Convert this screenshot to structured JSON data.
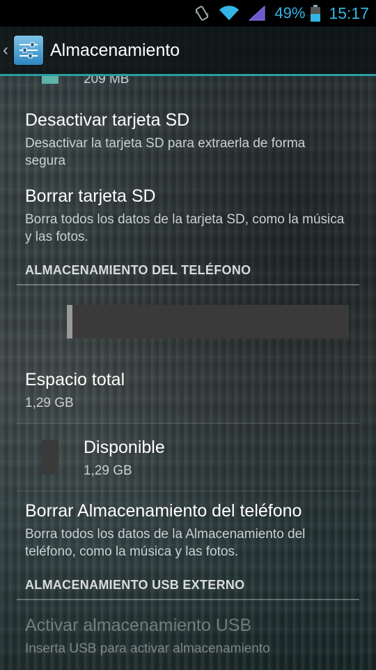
{
  "status_bar": {
    "battery_percent": "49%",
    "time": "15:17",
    "icons": [
      "vibrate-icon",
      "wifi-icon",
      "signal-icon",
      "battery-icon"
    ],
    "accent_color": "#33b5e5"
  },
  "action_bar": {
    "title": "Almacenamiento",
    "icon": "settings-sliders-icon"
  },
  "sd_card": {
    "partial_value": "209 MB",
    "swatch_color": "#5fb3a8",
    "unmount": {
      "title": "Desactivar tarjeta SD",
      "summary": "Desactivar la tarjeta SD para extraerla de forma segura"
    },
    "erase": {
      "title": "Borrar tarjeta SD",
      "summary": "Borra todos los datos de la tarjeta SD, como la música y las fotos."
    }
  },
  "phone_storage": {
    "header": "ALMACENAMIENTO DEL TELÉFONO",
    "usage_bar_used_fraction": 0.02,
    "total": {
      "title": "Espacio total",
      "value": "1,29 GB"
    },
    "available": {
      "title": "Disponible",
      "value": "1,29 GB",
      "swatch_color": "#3a3a3a"
    },
    "erase": {
      "title": "Borrar Almacenamiento del teléfono",
      "summary": "Borra todos los datos de la Almacenamiento del teléfono, como la música y las fotos."
    }
  },
  "usb_storage": {
    "header": "ALMACENAMIENTO USB EXTERNO",
    "mount": {
      "title": "Activar almacenamiento USB",
      "summary": "Inserta USB para activar almacenamiento"
    }
  }
}
